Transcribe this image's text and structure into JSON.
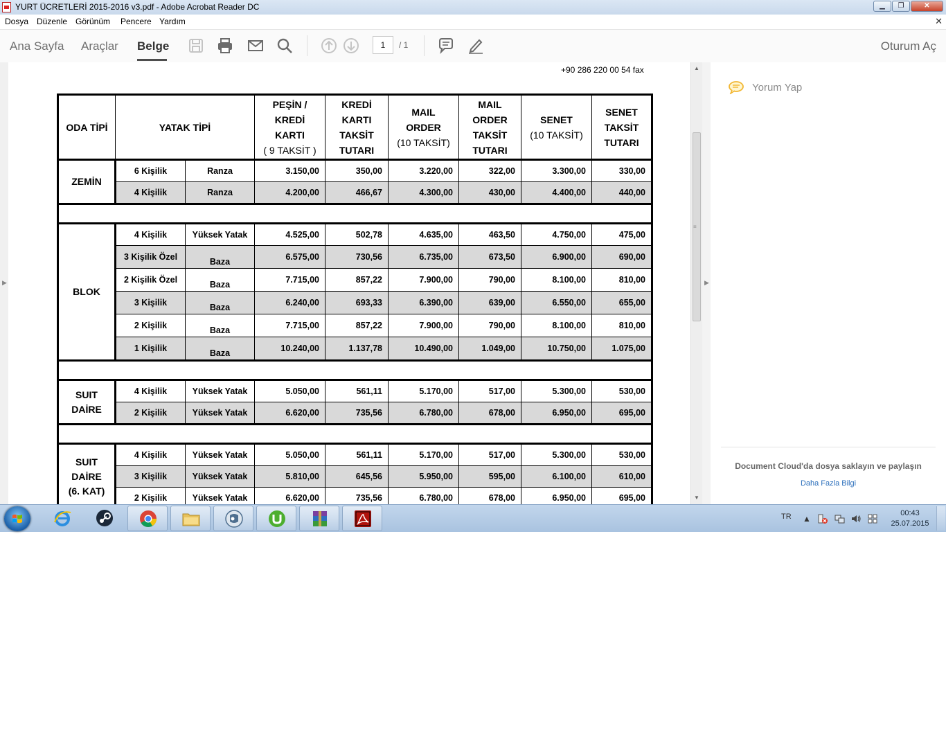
{
  "window": {
    "title": "YURT ÜCRETLERİ 2015-2016 v3.pdf - Adobe Acrobat Reader DC",
    "min_label": "▁",
    "max_label": "❐",
    "close_label": "✕"
  },
  "menu": {
    "items": [
      "Dosya",
      "Düzenle",
      "Görünüm",
      "Pencere",
      "Yardım"
    ],
    "close_label": "✕"
  },
  "toolbar": {
    "nav": [
      "Ana Sayfa",
      "Araçlar",
      "Belge"
    ],
    "active_tab": "Belge",
    "page_current": "1",
    "page_total": "/ 1",
    "signin": "Oturum Aç",
    "icons": [
      "save-icon",
      "print-icon",
      "mail-icon",
      "search-icon",
      "page-up-icon",
      "page-down-icon",
      "comment-icon",
      "sign-icon"
    ]
  },
  "document": {
    "fax_line": "+90 286 220 00 54 fax",
    "headers": {
      "room_type": "ODA TİPİ",
      "bed_type": "YATAK TİPİ",
      "cash": [
        "PEŞİN /",
        "KREDİ",
        "KARTI"
      ],
      "cash_sub": "( 9 TAKSİT )",
      "cc_inst": [
        "KREDİ",
        "KARTI",
        "TAKSİT",
        "TUTARI"
      ],
      "mail_order": [
        "MAIL",
        "ORDER"
      ],
      "mail_order_sub": "(10 TAKSİT)",
      "mail_inst": [
        "MAIL",
        "ORDER",
        "TAKSİT",
        "TUTARI"
      ],
      "senet": "SENET",
      "senet_sub": "(10 TAKSİT)",
      "senet_inst": [
        "SENET",
        "TAKSİT",
        "TUTARI"
      ]
    },
    "groups": [
      {
        "room": [
          "ZEMİN"
        ],
        "rows": [
          {
            "kisi": "6 Kişilik",
            "yatak": "Ranza",
            "v": [
              "3.150,00",
              "350,00",
              "3.220,00",
              "322,00",
              "3.300,00",
              "330,00"
            ]
          },
          {
            "kisi": "4 Kişilik",
            "yatak": "Ranza",
            "v": [
              "4.200,00",
              "466,67",
              "4.300,00",
              "430,00",
              "4.400,00",
              "440,00"
            ]
          }
        ]
      },
      {
        "room": [
          "BLOK"
        ],
        "rows": [
          {
            "kisi": "4 Kişilik",
            "yatak": "Yüksek Yatak",
            "v": [
              "4.525,00",
              "502,78",
              "4.635,00",
              "463,50",
              "4.750,00",
              "475,00"
            ]
          },
          {
            "kisi": "3 Kişilik Özel",
            "yatak": "Baza",
            "v": [
              "6.575,00",
              "730,56",
              "6.735,00",
              "673,50",
              "6.900,00",
              "690,00"
            ]
          },
          {
            "kisi": "2 Kişilik Özel",
            "yatak": "Baza",
            "v": [
              "7.715,00",
              "857,22",
              "7.900,00",
              "790,00",
              "8.100,00",
              "810,00"
            ]
          },
          {
            "kisi": "3 Kişilik",
            "yatak": "Baza",
            "v": [
              "6.240,00",
              "693,33",
              "6.390,00",
              "639,00",
              "6.550,00",
              "655,00"
            ]
          },
          {
            "kisi": "2 Kişilik",
            "yatak": "Baza",
            "v": [
              "7.715,00",
              "857,22",
              "7.900,00",
              "790,00",
              "8.100,00",
              "810,00"
            ]
          },
          {
            "kisi": "1 Kişilik",
            "yatak": "Baza",
            "v": [
              "10.240,00",
              "1.137,78",
              "10.490,00",
              "1.049,00",
              "10.750,00",
              "1.075,00"
            ]
          }
        ]
      },
      {
        "room": [
          "SUIT",
          "DAİRE"
        ],
        "rows": [
          {
            "kisi": "4 Kişilik",
            "yatak": "Yüksek Yatak",
            "v": [
              "5.050,00",
              "561,11",
              "5.170,00",
              "517,00",
              "5.300,00",
              "530,00"
            ]
          },
          {
            "kisi": "2 Kişilik",
            "yatak": "Yüksek Yatak",
            "v": [
              "6.620,00",
              "735,56",
              "6.780,00",
              "678,00",
              "6.950,00",
              "695,00"
            ]
          }
        ]
      },
      {
        "room": [
          "SUIT",
          "DAİRE",
          "(6. KAT)"
        ],
        "rows": [
          {
            "kisi": "4 Kişilik",
            "yatak": "Yüksek Yatak",
            "v": [
              "5.050,00",
              "561,11",
              "5.170,00",
              "517,00",
              "5.300,00",
              "530,00"
            ]
          },
          {
            "kisi": "3 Kişilik",
            "yatak": "Yüksek Yatak",
            "v": [
              "5.810,00",
              "645,56",
              "5.950,00",
              "595,00",
              "6.100,00",
              "610,00"
            ]
          },
          {
            "kisi": "2 Kişilik",
            "yatak": "Yüksek Yatak",
            "v": [
              "6.620,00",
              "735,56",
              "6.780,00",
              "678,00",
              "6.950,00",
              "695,00"
            ]
          }
        ]
      }
    ]
  },
  "side_panel": {
    "comment_label": "Yorum Yap",
    "cloud_text": "Document Cloud'da dosya saklayın ve paylaşın",
    "cloud_link": "Daha Fazla Bilgi"
  },
  "taskbar": {
    "apps": [
      "internet-explorer",
      "steam",
      "chrome",
      "file-explorer",
      "teamspeak",
      "utorrent",
      "winrar",
      "acrobat-reader"
    ],
    "lang": "TR",
    "time": "00:43",
    "date": "25.07.2015"
  },
  "colors": {
    "row_shade": "#d9d9d9",
    "taskbar": "#b7cde6",
    "link": "#2a6ebb"
  }
}
